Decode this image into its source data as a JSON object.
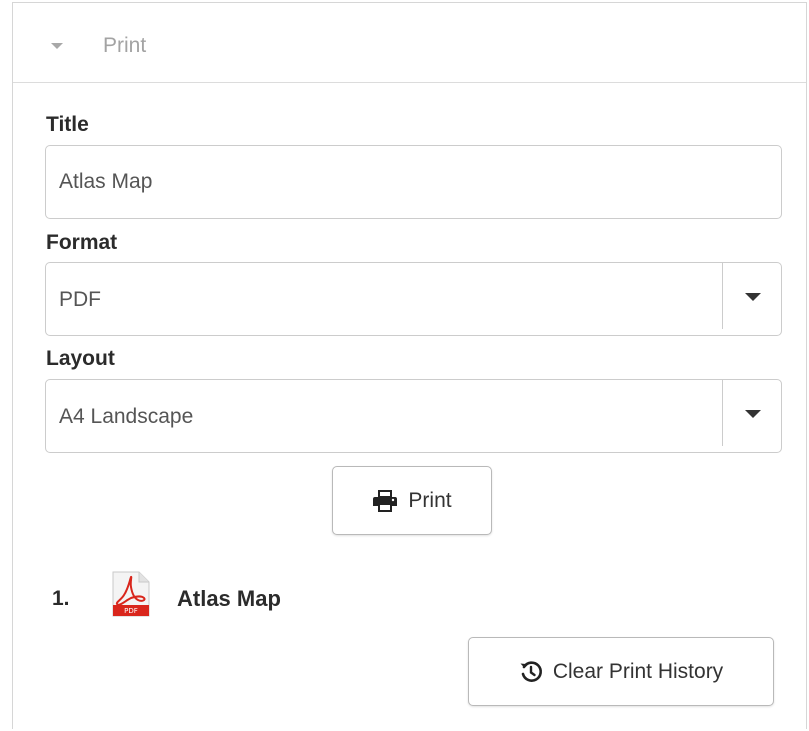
{
  "panel": {
    "title": "Print",
    "header_icon": "caret-down-icon"
  },
  "form": {
    "title_label": "Title",
    "title_value": "Atlas Map",
    "format_label": "Format",
    "format_value": "PDF",
    "layout_label": "Layout",
    "layout_value": "A4 Landscape"
  },
  "print_button": {
    "label": "Print",
    "icon": "printer-icon"
  },
  "history": {
    "items": [
      {
        "number": "1.",
        "icon": "pdf-file-icon",
        "title": "Atlas Map"
      }
    ],
    "clear_button": {
      "label": "Clear Print History",
      "icon": "history-icon"
    }
  },
  "colors": {
    "pdf_red": "#d9261c",
    "border": "#cccccc",
    "muted_text": "#a3a3a3"
  }
}
